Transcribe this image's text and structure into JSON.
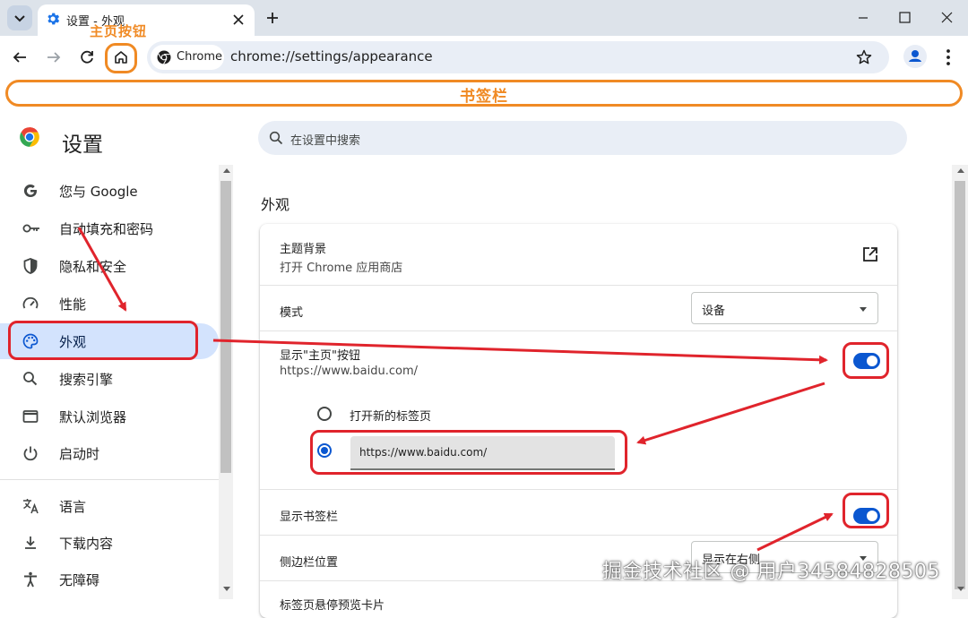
{
  "tab": {
    "title": "设置 - 外观"
  },
  "toolbar": {
    "chip_label": "Chrome",
    "url": "chrome://settings/appearance"
  },
  "annotations": {
    "home_button_label": "主页按钮",
    "bookmarks_bar_label": "书签栏",
    "watermark": "掘金技术社区 @ 用户34584828505"
  },
  "settings": {
    "title": "设置",
    "search_placeholder": "在设置中搜索",
    "nav": [
      {
        "label": "您与 Google",
        "icon": "google-icon"
      },
      {
        "label": "自动填充和密码",
        "icon": "key-icon"
      },
      {
        "label": "隐私和安全",
        "icon": "shield-icon"
      },
      {
        "label": "性能",
        "icon": "speedometer-icon"
      },
      {
        "label": "外观",
        "icon": "palette-icon"
      },
      {
        "label": "搜索引擎",
        "icon": "search-icon"
      },
      {
        "label": "默认浏览器",
        "icon": "browser-window-icon"
      },
      {
        "label": "启动时",
        "icon": "power-icon"
      },
      {
        "label": "语言",
        "icon": "translate-icon"
      },
      {
        "label": "下载内容",
        "icon": "download-icon"
      },
      {
        "label": "无障碍",
        "icon": "accessibility-icon"
      }
    ],
    "active_nav": "外观"
  },
  "appearance": {
    "section_title": "外观",
    "theme": {
      "title": "主题背景",
      "subtitle": "打开 Chrome 应用商店"
    },
    "mode": {
      "title": "模式",
      "value": "设备"
    },
    "home_button": {
      "title": "显示\"主页\"按钮",
      "subtitle": "https://www.baidu.com/",
      "enabled": true,
      "option_new_tab": "打开新的标签页",
      "custom_url": "https://www.baidu.com/",
      "selected": "custom_url"
    },
    "bookmarks_bar": {
      "title": "显示书签栏",
      "enabled": true
    },
    "side_panel": {
      "title": "侧边栏位置",
      "value": "显示在右侧"
    },
    "next_row_partial": "标签页悬停预览卡片"
  },
  "colors": {
    "accent_blue": "#0b57d0",
    "annotation_red": "#e0242c",
    "annotation_orange": "#f08a24",
    "nav_active_bg": "#d3e3fd",
    "tabstrip_bg": "#dde3ea"
  }
}
